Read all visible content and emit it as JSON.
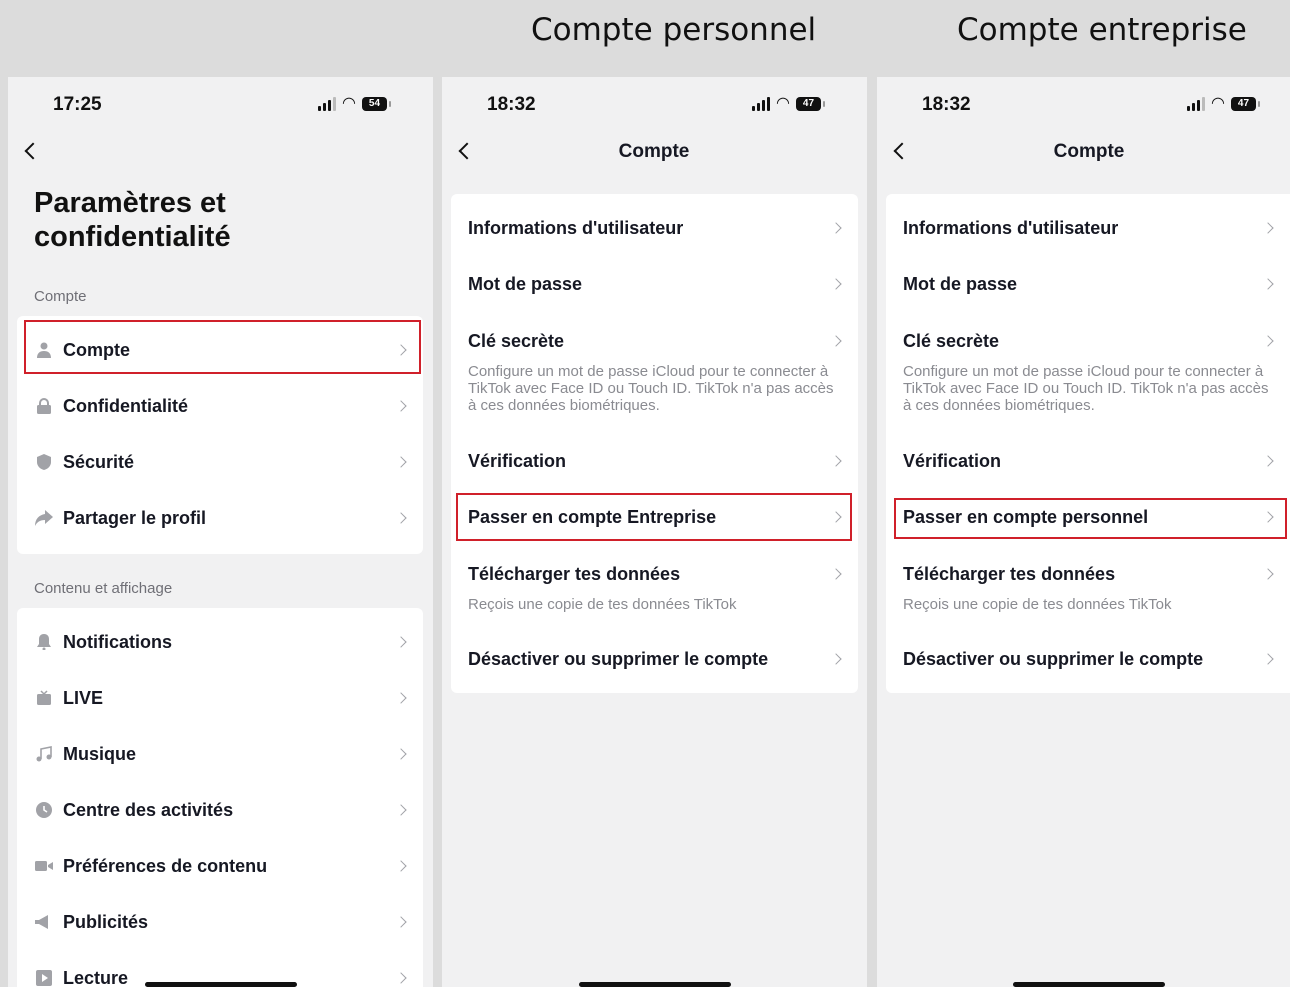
{
  "captions": {
    "personal": "Compte personnel",
    "business": "Compte entreprise"
  },
  "icons": {
    "back": "chevron-left-icon",
    "chevron": "chevron-right-icon",
    "wifi": "wifi-icon",
    "signal": "signal-icon",
    "battery": "battery-icon"
  },
  "colors": {
    "highlight": "#d0202a",
    "background": "#f1f1f2"
  },
  "phone1": {
    "time": "17:25",
    "battery": "54",
    "title": "Paramètres et confidentialité",
    "section1": "Compte",
    "items1": [
      {
        "label": "Compte",
        "icon": "person-icon"
      },
      {
        "label": "Confidentialité",
        "icon": "lock-icon"
      },
      {
        "label": "Sécurité",
        "icon": "shield-icon"
      },
      {
        "label": "Partager le profil",
        "icon": "share-arrow-icon"
      }
    ],
    "section2": "Contenu et affichage",
    "items2": [
      {
        "label": "Notifications",
        "icon": "bell-icon"
      },
      {
        "label": "LIVE",
        "icon": "tv-icon"
      },
      {
        "label": "Musique",
        "icon": "music-note-icon"
      },
      {
        "label": "Centre des activités",
        "icon": "clock-icon"
      },
      {
        "label": "Préférences de contenu",
        "icon": "video-camera-icon"
      },
      {
        "label": "Publicités",
        "icon": "megaphone-icon"
      },
      {
        "label": "Lecture",
        "icon": "play-icon"
      }
    ]
  },
  "phone2": {
    "time": "18:32",
    "battery": "47",
    "title": "Compte",
    "items": [
      {
        "label": "Informations d'utilisateur"
      },
      {
        "label": "Mot de passe"
      },
      {
        "label": "Clé secrète",
        "sub": "Configure un mot de passe iCloud pour te connecter à TikTok avec Face ID ou Touch ID. TikTok n'a pas accès à ces données biométriques."
      },
      {
        "label": "Vérification"
      },
      {
        "label": "Passer en compte Entreprise"
      },
      {
        "label": "Télécharger tes données",
        "sub": "Reçois une copie de tes données TikTok"
      },
      {
        "label": "Désactiver ou supprimer le compte"
      }
    ]
  },
  "phone3": {
    "time": "18:32",
    "battery": "47",
    "title": "Compte",
    "items": [
      {
        "label": "Informations d'utilisateur"
      },
      {
        "label": "Mot de passe"
      },
      {
        "label": "Clé secrète",
        "sub": "Configure un mot de passe iCloud pour te connecter à TikTok avec Face ID ou Touch ID. TikTok n'a pas accès à ces données biométriques."
      },
      {
        "label": "Vérification"
      },
      {
        "label": "Passer en compte personnel"
      },
      {
        "label": "Télécharger tes données",
        "sub": "Reçois une copie de tes données TikTok"
      },
      {
        "label": "Désactiver ou supprimer le compte"
      }
    ]
  }
}
